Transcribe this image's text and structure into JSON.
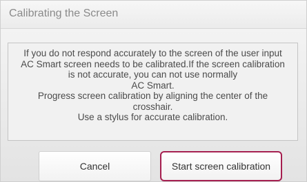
{
  "dialog": {
    "title": "Calibrating the Screen",
    "message_lines": [
      "If you do not respond accurately to the screen of the user input",
      "AC Smart screen needs to be calibrated.If the screen calibration",
      "is not accurate, you can not use normally",
      "AC Smart.",
      "Progress screen calibration by aligning the center of the",
      "crosshair.",
      "Use a stylus for accurate calibration."
    ],
    "buttons": {
      "cancel_label": "Cancel",
      "start_label": "Start screen calibration"
    }
  },
  "colors": {
    "highlight_border": "#a51e4f",
    "title_text": "#8a8a8a",
    "body_text": "#4a4a4a"
  }
}
